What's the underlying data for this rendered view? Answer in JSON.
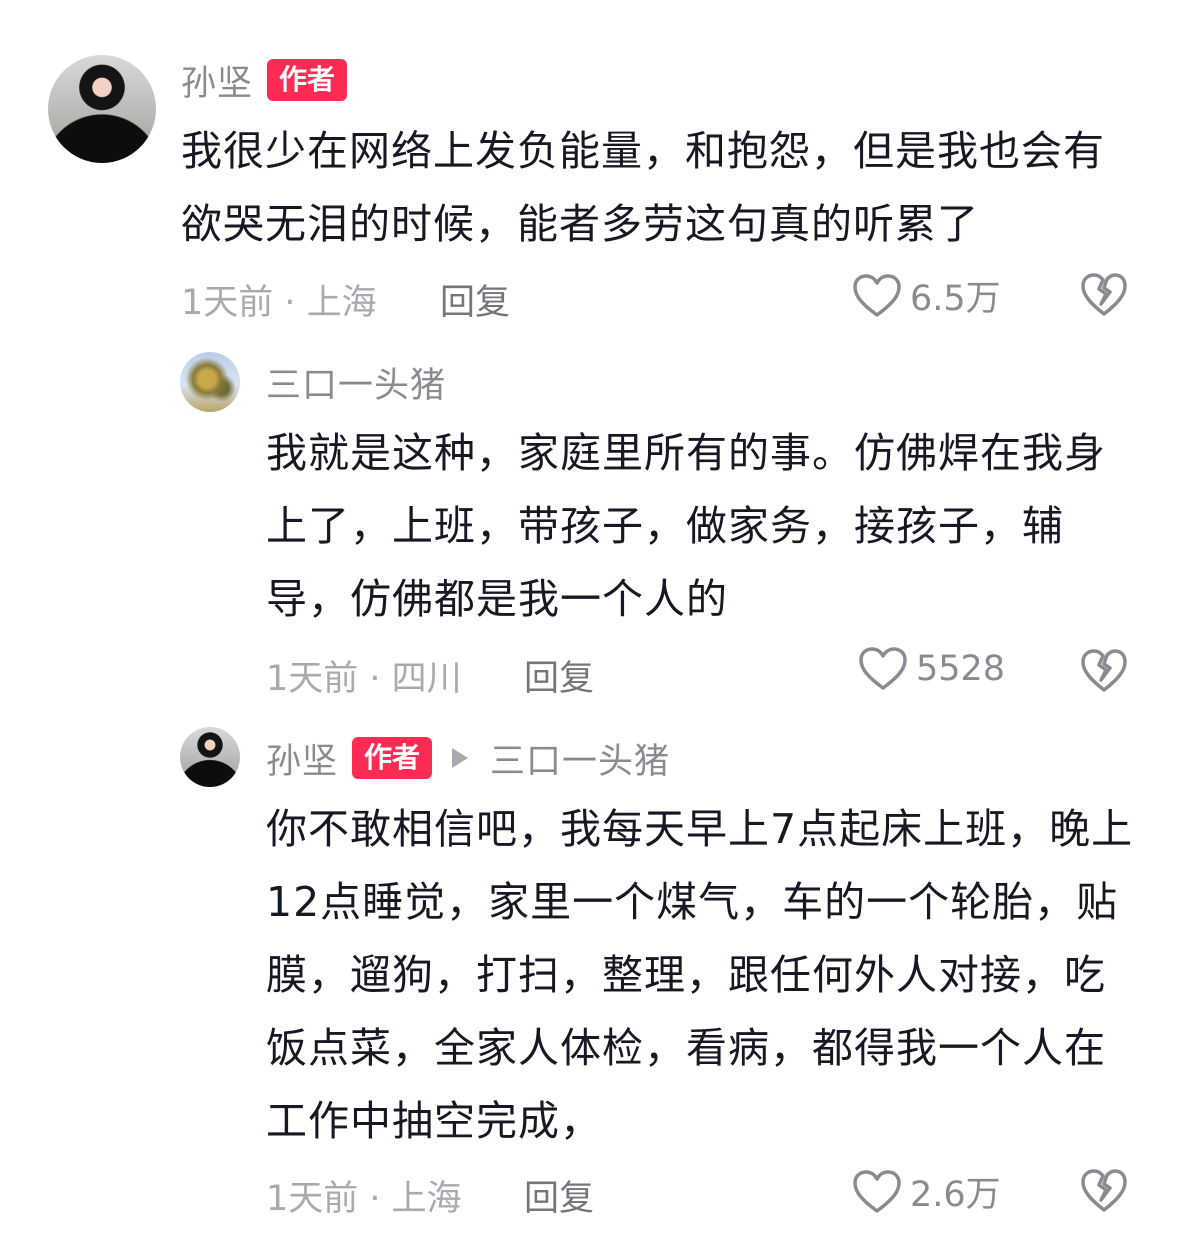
{
  "comments": [
    {
      "username": "孙坚",
      "badge": "作者",
      "text": "我很少在网络上发负能量，和抱怨，但是我也会有欲哭无泪的时候，能者多劳这句真的听累了",
      "meta": "1天前 · 上海",
      "reply_label": "回复",
      "likes": "6.5万"
    },
    {
      "username": "三口一头猪",
      "text": "我就是这种，家庭里所有的事。仿佛焊在我身上了，上班，带孩子，做家务，接孩子，辅导，仿佛都是我一个人的",
      "meta": "1天前 · 四川",
      "reply_label": "回复",
      "likes": "5528"
    },
    {
      "username": "孙坚",
      "badge": "作者",
      "reply_to": "三口一头猪",
      "text": "你不敢相信吧，我每天早上7点起床上班，晚上12点睡觉，家里一个煤气，车的一个轮胎，贴膜，遛狗，打扫，整理，跟任何外人对接，吃饭点菜，全家人体检，看病，都得我一个人在工作中抽空完成，",
      "meta": "1天前 · 上海",
      "reply_label": "回复",
      "likes": "2.6万"
    }
  ],
  "icons": {
    "like": "heart-outline-icon",
    "dislike": "broken-heart-icon"
  },
  "colors": {
    "author_badge": "#fe2c55",
    "username": "#8a8b91",
    "meta": "#a9aab0"
  }
}
